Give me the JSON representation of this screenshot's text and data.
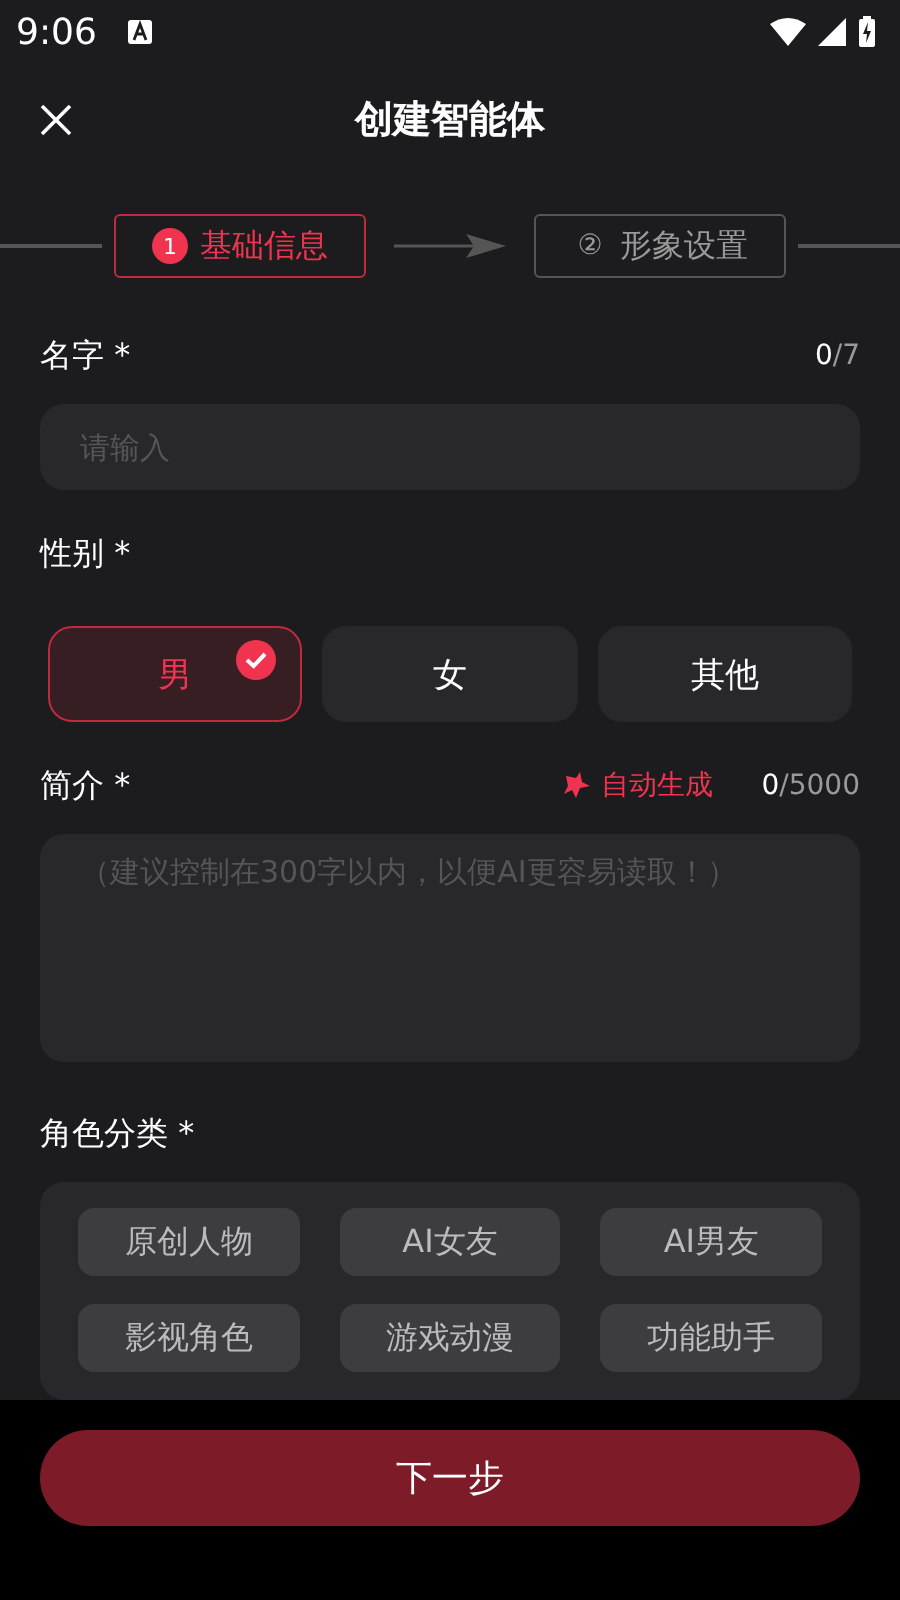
{
  "status_bar": {
    "time": "9:06"
  },
  "header": {
    "title": "创建智能体"
  },
  "steps": [
    {
      "number": "1",
      "label": "基础信息",
      "selected": true
    },
    {
      "number": "②",
      "label": "形象设置",
      "selected": false
    }
  ],
  "name_field": {
    "label": "名字 *",
    "count": "0",
    "max": "/7",
    "placeholder": "请输入"
  },
  "gender": {
    "label": "性别 *",
    "options": [
      {
        "label": "男",
        "selected": true
      },
      {
        "label": "女",
        "selected": false
      },
      {
        "label": "其他",
        "selected": false
      }
    ]
  },
  "intro": {
    "label": "简介 *",
    "auto_generate": "自动生成",
    "count": "0",
    "max": "/5000",
    "placeholder": "（建议控制在300字以内，以便AI更容易读取！）"
  },
  "category": {
    "label": "角色分类 *",
    "options": [
      {
        "label": "原创人物"
      },
      {
        "label": "AI女友"
      },
      {
        "label": "AI男友"
      },
      {
        "label": "影视角色"
      },
      {
        "label": "游戏动漫"
      },
      {
        "label": "功能助手"
      }
    ]
  },
  "next_button": "下一步"
}
